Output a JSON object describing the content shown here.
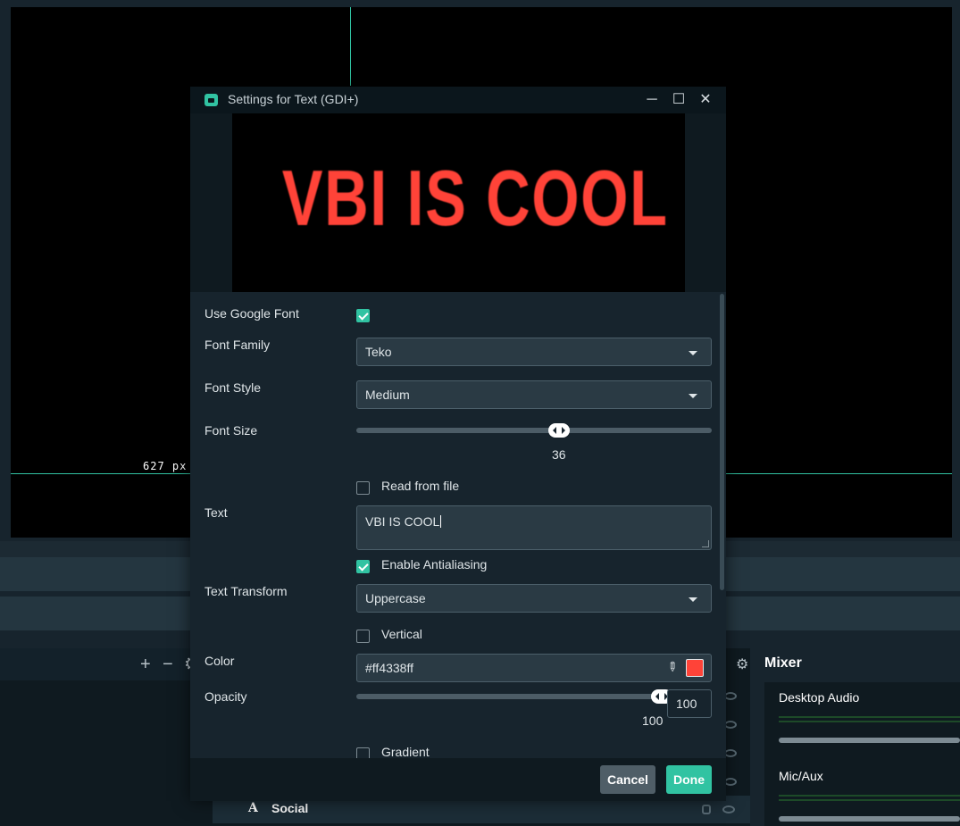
{
  "canvas": {
    "dimension_label": "627 px"
  },
  "sources": {
    "add_symbol": "+",
    "remove_symbol": "−",
    "visible_row": {
      "icon": "A",
      "label": "Social"
    }
  },
  "mixer": {
    "title": "Mixer",
    "channels": [
      {
        "name": "Desktop Audio"
      },
      {
        "name": "Mic/Aux"
      }
    ]
  },
  "dialog": {
    "title": "Settings for Text (GDI+)",
    "window_controls": {
      "minimize": "─",
      "maximize": "☐",
      "close": "✕"
    },
    "preview_text": "VBI IS COOL",
    "fields": {
      "use_google_font": {
        "label": "Use Google Font",
        "checked": true
      },
      "font_family": {
        "label": "Font Family",
        "value": "Teko"
      },
      "font_style": {
        "label": "Font Style",
        "value": "Medium"
      },
      "font_size": {
        "label": "Font Size",
        "value": "36",
        "fraction": 0.57
      },
      "read_from_file": {
        "label": "Read from file",
        "checked": false
      },
      "text": {
        "label": "Text",
        "value": "VBI IS COOL"
      },
      "enable_antialiasing": {
        "label": "Enable Antialiasing",
        "checked": true
      },
      "text_transform": {
        "label": "Text Transform",
        "value": "Uppercase"
      },
      "vertical": {
        "label": "Vertical",
        "checked": false
      },
      "color": {
        "label": "Color",
        "value": "#ff4338ff",
        "swatch": "#ff4338"
      },
      "opacity": {
        "label": "Opacity",
        "value": "100",
        "input_value": "100",
        "fraction": 1.0
      },
      "gradient": {
        "label": "Gradient",
        "checked": false
      }
    },
    "buttons": {
      "cancel": "Cancel",
      "done": "Done"
    }
  },
  "colors": {
    "accent": "#31c3a2",
    "text_color": "#ff4338",
    "background": "#17242d"
  }
}
